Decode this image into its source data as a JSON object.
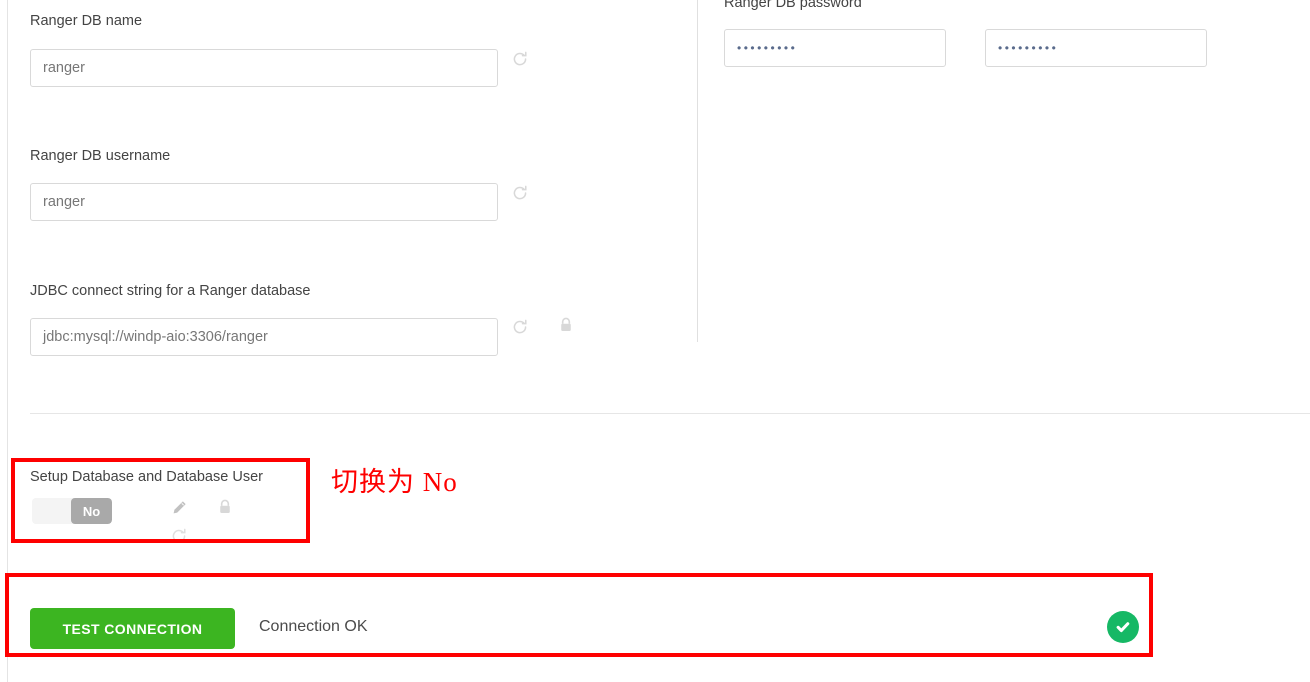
{
  "form": {
    "fields": [
      {
        "id": "ranger-db-name",
        "label": "Ranger DB name",
        "value": "ranger",
        "adornments": [
          "refresh-icon"
        ]
      },
      {
        "id": "ranger-db-username",
        "label": "Ranger DB username",
        "value": "ranger",
        "adornments": [
          "refresh-icon"
        ]
      },
      {
        "id": "jdbc-connect-string",
        "label": "JDBC connect string for a Ranger database",
        "value": "jdbc:mysql://windp-aio:3306/ranger",
        "adornments": [
          "refresh-icon",
          "lock-icon"
        ]
      }
    ],
    "password_section": {
      "label": "Ranger DB password",
      "primary_value": "•••••••••",
      "confirm_value": "•••••••••"
    },
    "setup_database": {
      "label": "Setup Database and Database User",
      "toggle_value": "No",
      "adornments": [
        "pencil-icon",
        "lock-icon",
        "refresh-icon"
      ]
    }
  },
  "test_connection": {
    "button_label": "TEST CONNECTION",
    "status": "Connection OK",
    "status_icon": "check-circle-icon"
  },
  "annotations": {
    "note": "切换为 No",
    "color": "#fe0000"
  },
  "colors": {
    "accent_green": "#3cb521",
    "success_green": "#16b865",
    "annotation_red": "#fe0000",
    "toggle_knob_gray": "#a9a9a9"
  }
}
